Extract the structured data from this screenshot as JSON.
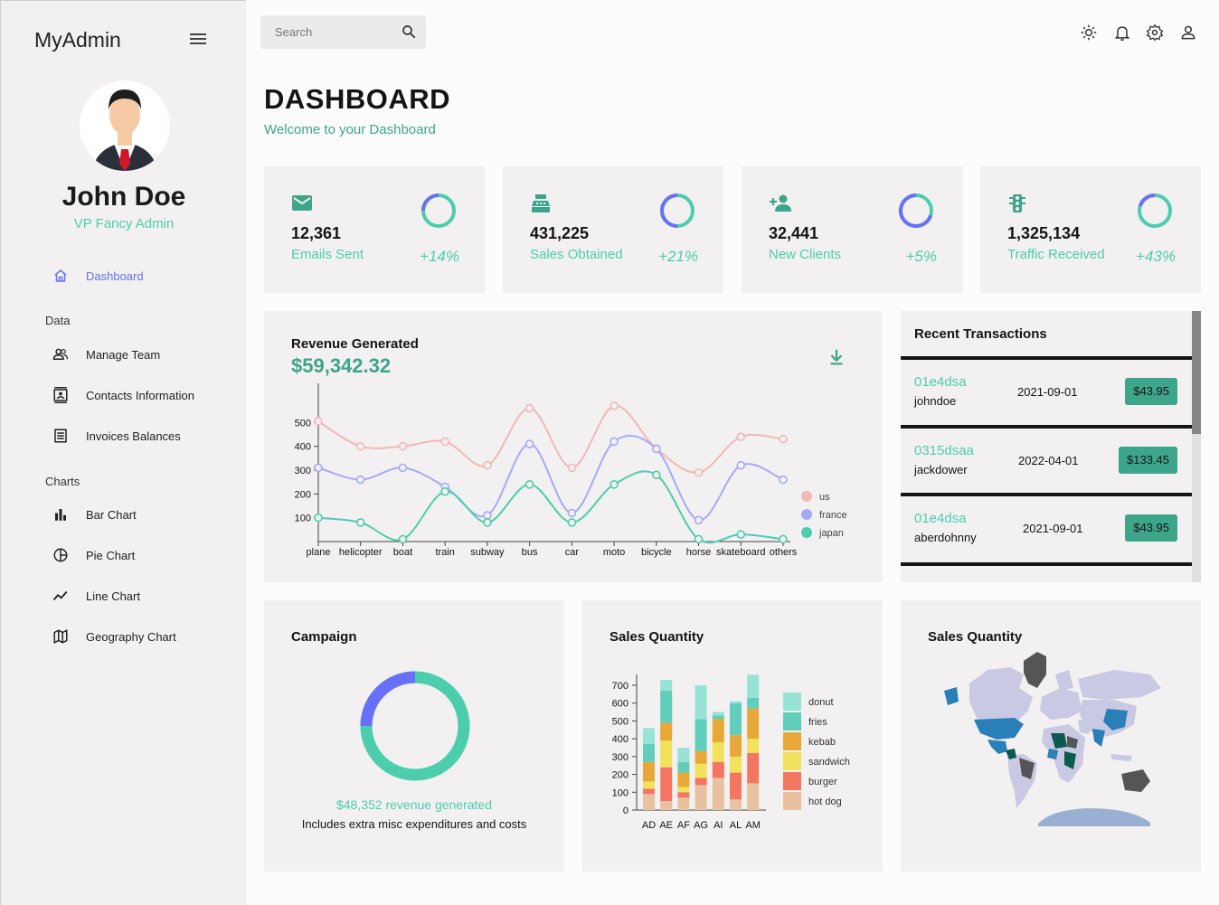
{
  "sidebar": {
    "brand": "MyAdmin",
    "user_name": "John Doe",
    "user_role": "VP Fancy Admin",
    "items": {
      "dashboard": "Dashboard",
      "data_section": "Data",
      "manage_team": "Manage Team",
      "contacts": "Contacts Information",
      "invoices": "Invoices Balances",
      "charts_section": "Charts",
      "bar_chart": "Bar Chart",
      "pie_chart": "Pie Chart",
      "line_chart": "Line Chart",
      "geography_chart": "Geography Chart"
    }
  },
  "topbar": {
    "search_placeholder": "Search",
    "icons": [
      "light-mode-icon",
      "notifications-icon",
      "settings-icon",
      "person-icon"
    ]
  },
  "header": {
    "title": "DASHBOARD",
    "subtitle": "Welcome to your Dashboard"
  },
  "stats": [
    {
      "value": "12,361",
      "label": "Emails Sent",
      "increase": "+14%",
      "progress": 0.75,
      "icon": "email-icon"
    },
    {
      "value": "431,225",
      "label": "Sales Obtained",
      "increase": "+21%",
      "progress": 0.5,
      "icon": "point-of-sale-icon"
    },
    {
      "value": "32,441",
      "label": "New Clients",
      "increase": "+5%",
      "progress": 0.3,
      "icon": "person-add-icon"
    },
    {
      "value": "1,325,134",
      "label": "Traffic Received",
      "increase": "+43%",
      "progress": 0.8,
      "icon": "traffic-icon"
    }
  ],
  "revenue": {
    "title": "Revenue Generated",
    "amount": "$59,342.32"
  },
  "transactions": {
    "title": "Recent Transactions",
    "rows": [
      {
        "id": "01e4dsa",
        "user": "johndoe",
        "date": "2021-09-01",
        "cost": "$43.95"
      },
      {
        "id": "0315dsaa",
        "user": "jackdower",
        "date": "2022-04-01",
        "cost": "$133.45"
      },
      {
        "id": "01e4dsa",
        "user": "aberdohnny",
        "date": "2021-09-01",
        "cost": "$43.95"
      }
    ]
  },
  "campaign": {
    "title": "Campaign",
    "revenue_text": "$48,352 revenue generated",
    "note": "Includes extra misc expenditures and costs",
    "progress": 0.75
  },
  "sales_bar": {
    "title": "Sales Quantity"
  },
  "sales_geo": {
    "title": "Sales Quantity"
  },
  "colors": {
    "accent": "#4cceac",
    "accent_dark": "#3da58a",
    "blue": "#6870fa",
    "card": "#f2f0f0"
  },
  "chart_data": [
    {
      "type": "line",
      "x": [
        "plane",
        "helicopter",
        "boat",
        "train",
        "subway",
        "bus",
        "car",
        "moto",
        "bicycle",
        "horse",
        "skateboard",
        "others"
      ],
      "series": [
        {
          "name": "us",
          "color": "#f2b8b5",
          "values": [
            505,
            400,
            400,
            420,
            320,
            560,
            310,
            570,
            390,
            290,
            440,
            430
          ]
        },
        {
          "name": "france",
          "color": "#a4a9fc",
          "values": [
            310,
            260,
            310,
            230,
            110,
            410,
            120,
            420,
            390,
            90,
            320,
            260
          ]
        },
        {
          "name": "japan",
          "color": "#4cceac",
          "values": [
            100,
            80,
            10,
            210,
            80,
            240,
            80,
            240,
            280,
            10,
            30,
            10
          ]
        }
      ],
      "yticks": [
        100,
        200,
        300,
        400,
        500
      ],
      "ylim": [
        0,
        600
      ],
      "legend": "bottom-right"
    },
    {
      "type": "bar",
      "stacked": true,
      "categories": [
        "AD",
        "AE",
        "AF",
        "AG",
        "AI",
        "AL",
        "AM"
      ],
      "series": [
        {
          "name": "hot dog",
          "color": "#e8c1a0",
          "values": [
            90,
            50,
            70,
            140,
            180,
            60,
            150
          ]
        },
        {
          "name": "burger",
          "color": "#f47560",
          "values": [
            30,
            190,
            30,
            40,
            90,
            150,
            170
          ]
        },
        {
          "name": "sandwich",
          "color": "#f1e15b",
          "values": [
            40,
            150,
            30,
            80,
            110,
            90,
            80
          ]
        },
        {
          "name": "kebab",
          "color": "#e8a838",
          "values": [
            110,
            100,
            80,
            70,
            130,
            120,
            170
          ]
        },
        {
          "name": "fries",
          "color": "#61cdbb",
          "values": [
            100,
            180,
            60,
            180,
            20,
            180,
            60
          ]
        },
        {
          "name": "donut",
          "color": "#97e3d5",
          "values": [
            90,
            60,
            80,
            190,
            20,
            10,
            130
          ]
        }
      ],
      "yticks": [
        0,
        100,
        200,
        300,
        400,
        500,
        600,
        700
      ],
      "ylim": [
        0,
        700
      ],
      "legend": "right"
    }
  ]
}
